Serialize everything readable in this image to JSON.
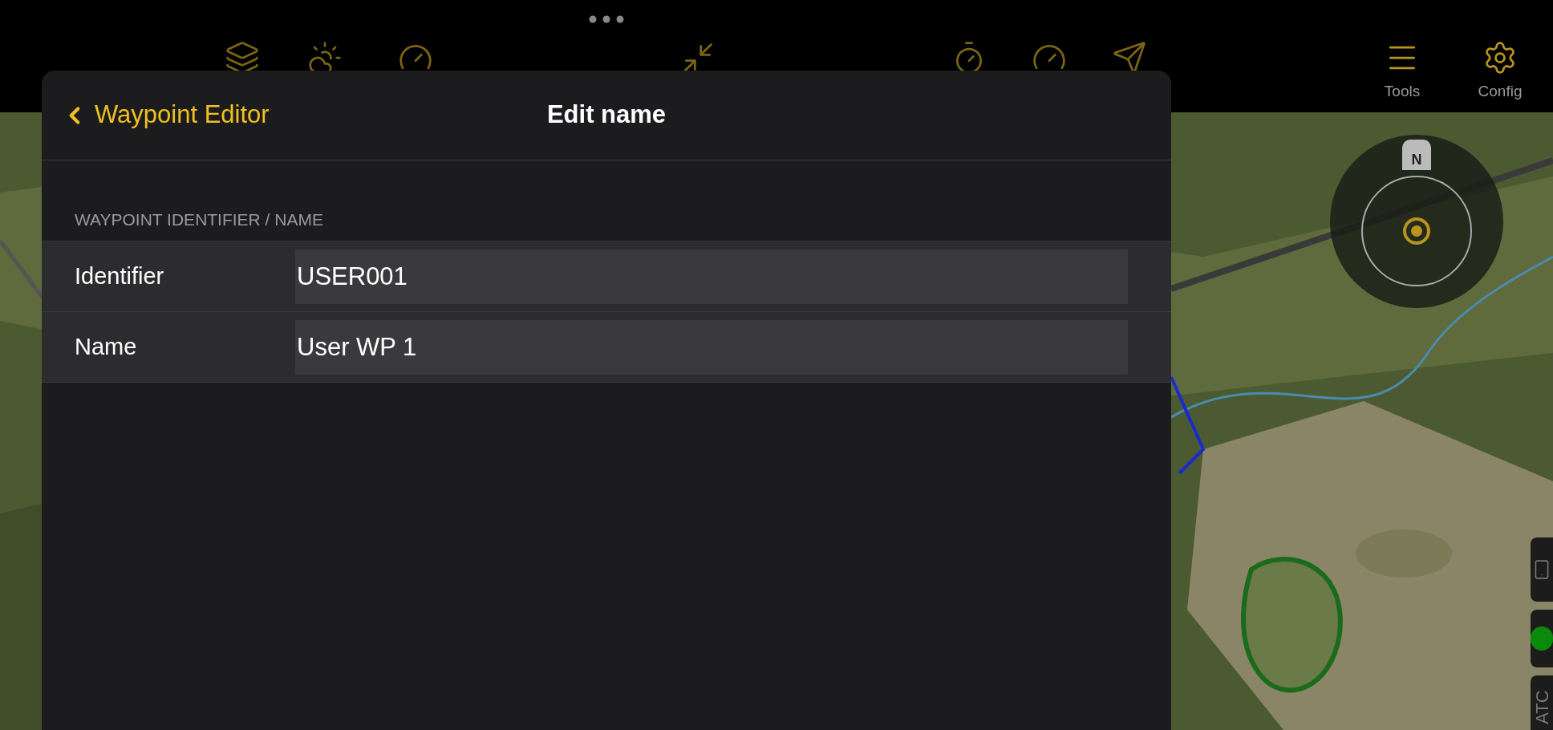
{
  "toolbar": {
    "icons": [
      {
        "kind": "layers"
      },
      {
        "kind": "weather"
      },
      {
        "kind": "gauge"
      },
      {
        "kind": "collapse"
      },
      {
        "kind": "timer"
      },
      {
        "kind": "speed"
      },
      {
        "kind": "send"
      }
    ],
    "buttons": [
      {
        "kind": "tools",
        "label": "Tools"
      },
      {
        "kind": "config",
        "label": "Config"
      }
    ]
  },
  "panel": {
    "back_label": "Waypoint Editor",
    "title": "Edit name",
    "section_header": "WAYPOINT IDENTIFIER / NAME",
    "fields": [
      {
        "label": "Identifier",
        "value": "USER001"
      },
      {
        "label": "Name",
        "value": "User WP 1"
      }
    ]
  },
  "map": {
    "compass_label": "N"
  },
  "side_tabs": [
    {
      "kind": "device"
    },
    {
      "kind": "status",
      "color": "#0a8a0a"
    },
    {
      "kind": "text",
      "label": "ATC"
    }
  ]
}
